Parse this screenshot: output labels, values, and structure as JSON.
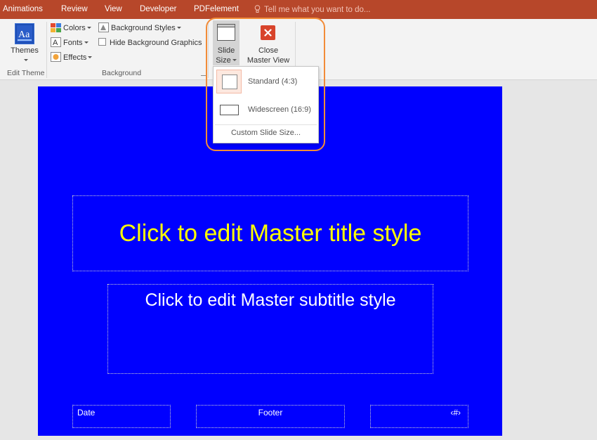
{
  "tabs": [
    "Animations",
    "Review",
    "View",
    "Developer",
    "PDFelement"
  ],
  "tell_me": "Tell me what you want to do...",
  "ribbon": {
    "themes_label": "Themes",
    "edit_theme_group": "Edit Theme",
    "colors_label": "Colors",
    "fonts_label": "Fonts",
    "effects_label": "Effects",
    "background_styles_label": "Background Styles",
    "hide_bg_graphics_label": "Hide Background Graphics",
    "background_group": "Background",
    "slide_size_line1": "Slide",
    "slide_size_line2": "Size",
    "close_master_line1": "Close",
    "close_master_line2": "Master View"
  },
  "slide_size_menu": {
    "standard": "Standard (4:3)",
    "widescreen": "Widescreen (16:9)",
    "custom": "Custom Slide Size..."
  },
  "slide": {
    "title": "Click to edit Master title style",
    "subtitle": "Click to edit Master subtitle style",
    "date": "Date",
    "footer": "Footer",
    "number": "‹#›"
  },
  "colors": {
    "tab_bar": "#b7472a",
    "slide_bg": "#0000ff",
    "title_text": "#ffff00",
    "highlight": "#f28c38"
  }
}
